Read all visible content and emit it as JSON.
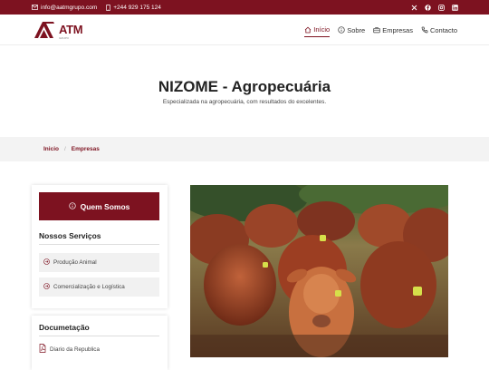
{
  "topbar": {
    "email": "info@aatmgrupo.com",
    "phone": "+244 929 175 124",
    "socials": [
      "x-icon",
      "facebook-icon",
      "instagram-icon",
      "linkedin-icon"
    ]
  },
  "header": {
    "logo_text": "ATM",
    "logo_sub": "GRUPO",
    "nav": [
      {
        "label": "Início",
        "icon": "home-icon",
        "active": true
      },
      {
        "label": "Sobre",
        "icon": "info-icon",
        "active": false
      },
      {
        "label": "Empresas",
        "icon": "briefcase-icon",
        "active": false
      },
      {
        "label": "Contacto",
        "icon": "phone-icon",
        "active": false
      }
    ]
  },
  "hero": {
    "title": "NIZOME - Agropecuária",
    "subtitle": "Especializada na agropecuária, com resultados do excelentes."
  },
  "breadcrumb": {
    "home": "Inicio",
    "separator": "/",
    "current": "Empresas"
  },
  "sidebar": {
    "about_button": "Quem Somos",
    "services_title": "Nossos Serviços",
    "services": [
      {
        "label": "Produção Animal"
      },
      {
        "label": "Comercialização e Logística"
      }
    ],
    "docs_title": "Documetação",
    "docs": [
      {
        "label": "Diario da Republica"
      }
    ]
  },
  "colors": {
    "brand": "#7d1220",
    "panel": "#f1f1f1"
  }
}
